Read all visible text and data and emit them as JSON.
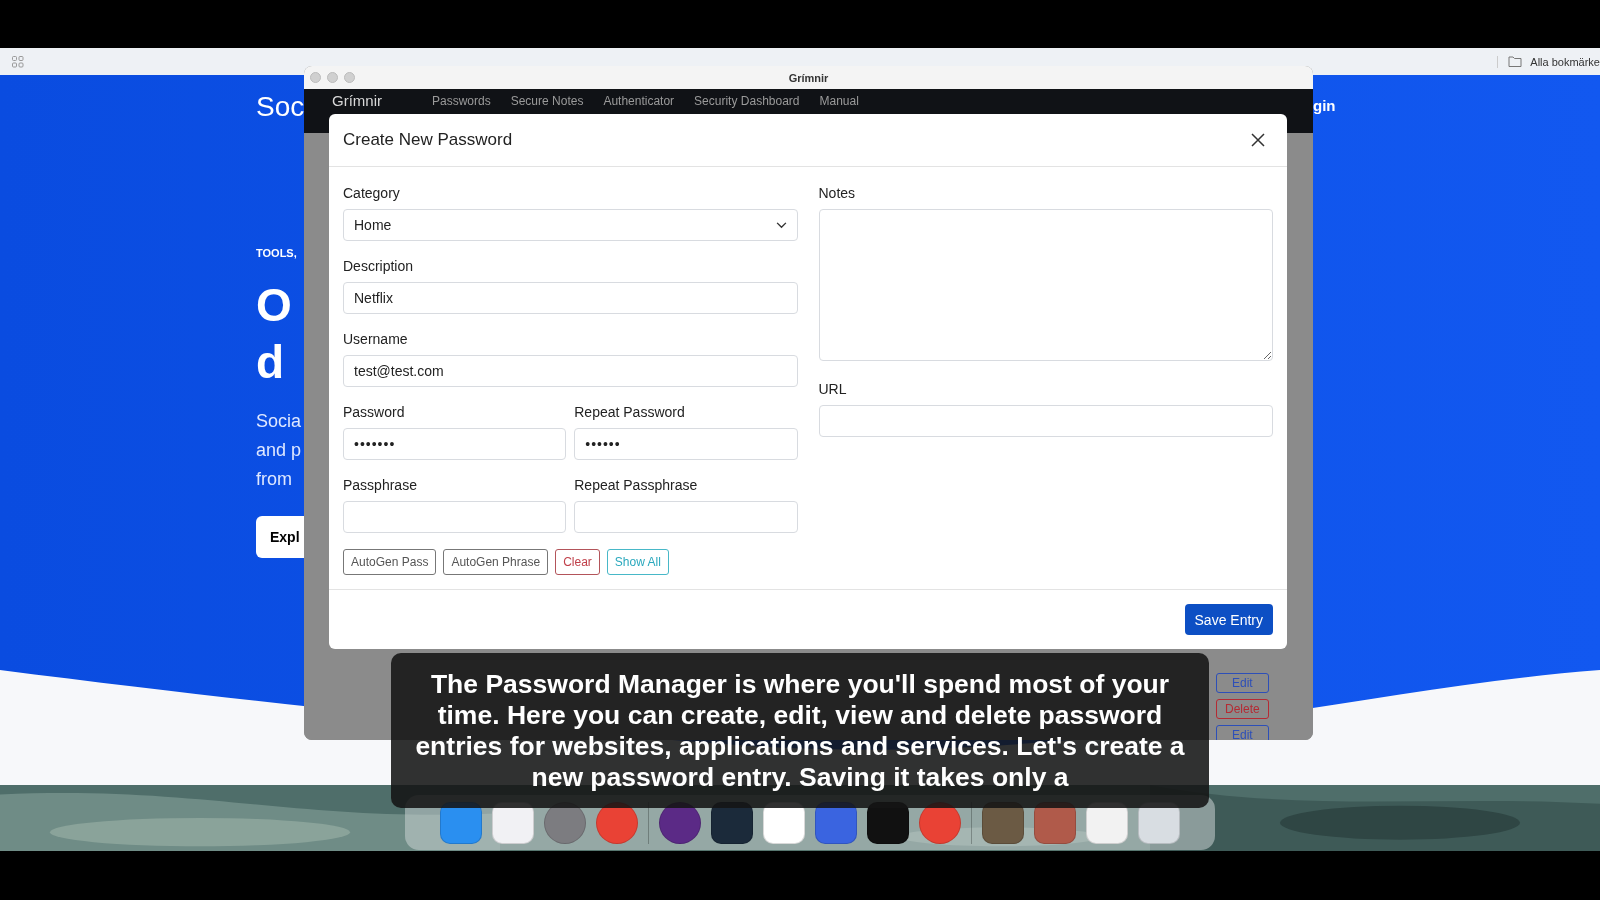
{
  "browser": {
    "bookmarks_label": "Alla bokmärke"
  },
  "page": {
    "brand": "Soc",
    "login": "gin",
    "eyebrow": "TOOLS,",
    "heading_lines": [
      "O",
      "d"
    ],
    "lead_lines": [
      "Socia",
      "and p",
      "from"
    ],
    "cta": "Expl"
  },
  "app_window": {
    "title": "Grímnir",
    "nav": {
      "brand": "Grímnir",
      "items": [
        "Passwords",
        "Secure Notes",
        "Authenticator",
        "Security Dashboard",
        "Manual"
      ]
    },
    "row_actions": [
      {
        "label": "Edit",
        "kind": "edit"
      },
      {
        "label": "Delete",
        "kind": "delete"
      },
      {
        "label": "Edit",
        "kind": "edit"
      }
    ]
  },
  "modal": {
    "title": "Create New Password",
    "category": {
      "label": "Category",
      "value": "Home"
    },
    "description": {
      "label": "Description",
      "value": "Netflix"
    },
    "username": {
      "label": "Username",
      "value": "test@test.com"
    },
    "password": {
      "label": "Password",
      "value": "•••••••"
    },
    "repeat_password": {
      "label": "Repeat Password",
      "value": "••••••"
    },
    "passphrase": {
      "label": "Passphrase"
    },
    "repeat_passphrase": {
      "label": "Repeat Passphrase"
    },
    "notes": {
      "label": "Notes"
    },
    "url": {
      "label": "URL"
    },
    "actions": [
      {
        "label": "AutoGen Pass",
        "kind": "secondary"
      },
      {
        "label": "AutoGen Phrase",
        "kind": "secondary"
      },
      {
        "label": "Clear",
        "kind": "danger"
      },
      {
        "label": "Show All",
        "kind": "info"
      }
    ],
    "save": "Save Entry"
  },
  "subtitle": "The Password Manager is where you'll spend most of your time. Here you can create, edit, view and delete password entries for websites, applications and services. Let's create a new password entry. Saving it takes only a"
}
